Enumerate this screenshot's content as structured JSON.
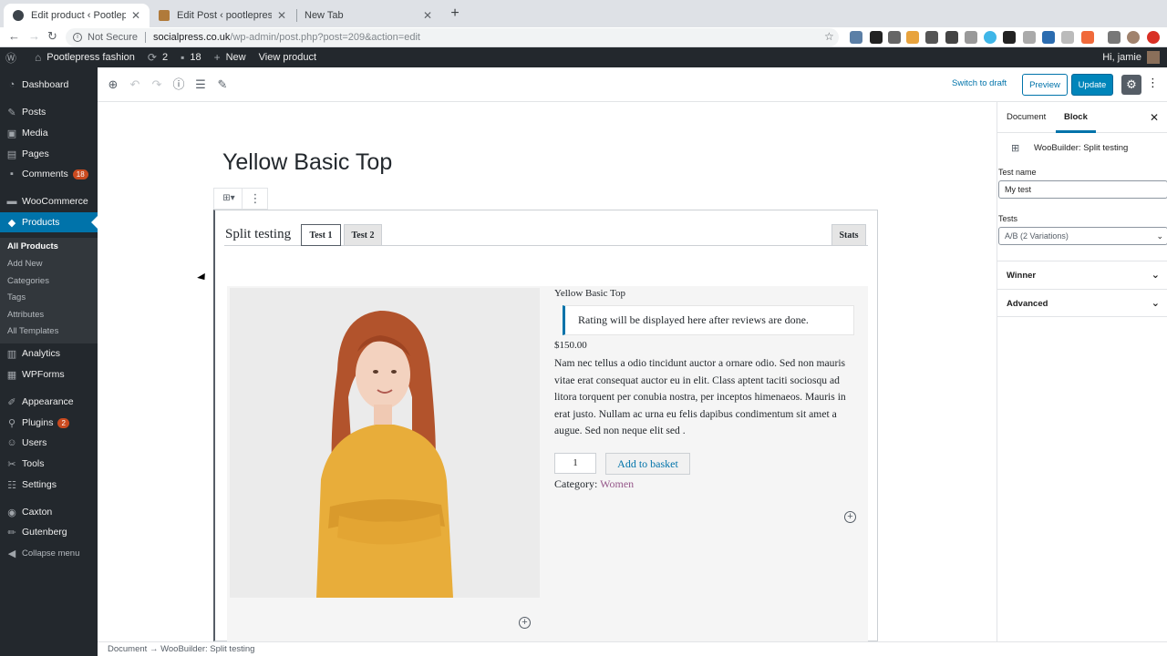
{
  "browser": {
    "tabs": [
      {
        "title": "Edit product ‹ Pootlepress fashion",
        "active": true
      },
      {
        "title": "Edit Post ‹ pootlepress — WordPress",
        "active": false
      },
      {
        "title": "New Tab",
        "active": false
      }
    ],
    "security": "Not Secure",
    "url_host": "socialpress.co.uk",
    "url_path": "/wp-admin/post.php?post=209&action=edit"
  },
  "adminbar": {
    "site": "Pootlepress fashion",
    "updates": "2",
    "comments": "18",
    "new": "New",
    "view": "View product",
    "howdy": "Hi, jamie"
  },
  "sidebar": {
    "items": [
      {
        "label": "Dashboard",
        "icon": "dashboard-icon"
      },
      {
        "label": "Posts",
        "icon": "pin-icon"
      },
      {
        "label": "Media",
        "icon": "media-icon"
      },
      {
        "label": "Pages",
        "icon": "pages-icon"
      },
      {
        "label": "Comments",
        "icon": "comment-icon",
        "badge": "18"
      },
      {
        "label": "WooCommerce",
        "icon": "woo-icon"
      },
      {
        "label": "Products",
        "icon": "products-icon"
      },
      {
        "label": "Analytics",
        "icon": "chart-icon"
      },
      {
        "label": "WPForms",
        "icon": "forms-icon"
      },
      {
        "label": "Appearance",
        "icon": "brush-icon"
      },
      {
        "label": "Plugins",
        "icon": "plugin-icon",
        "badge": "2"
      },
      {
        "label": "Users",
        "icon": "users-icon"
      },
      {
        "label": "Tools",
        "icon": "wrench-icon"
      },
      {
        "label": "Settings",
        "icon": "settings-icon"
      },
      {
        "label": "Caxton",
        "icon": "caxton-icon"
      },
      {
        "label": "Gutenberg",
        "icon": "pencil-icon"
      },
      {
        "label": "Collapse menu",
        "icon": "collapse-icon"
      }
    ],
    "submenu": [
      "All Products",
      "Add New",
      "Categories",
      "Tags",
      "Attributes",
      "All Templates"
    ]
  },
  "editor": {
    "switch_draft": "Switch to draft",
    "preview": "Preview",
    "update": "Update"
  },
  "content": {
    "title": "Yellow Basic Top",
    "split_label": "Split testing",
    "test_tabs": [
      "Test 1",
      "Test 2"
    ],
    "stats": "Stats",
    "product_title": "Yellow Basic Top",
    "rating_notice": "Rating will be displayed here after reviews are done.",
    "price": "$150.00",
    "description": "Nam nec tellus a odio tincidunt auctor a ornare odio. Sed non mauris vitae erat consequat auctor eu in elit. Class aptent taciti sociosqu ad litora torquent per conubia nostra, per inceptos himenaeos. Mauris in erat justo. Nullam ac urna eu felis dapibus condimentum sit amet a augue. Sed non neque elit sed .",
    "quantity": "1",
    "add_to_basket": "Add to basket",
    "category_label": "Category:",
    "category_value": "Women"
  },
  "panel": {
    "tabs": [
      "Document",
      "Block"
    ],
    "block_name": "WooBuilder: Split testing",
    "test_name_label": "Test name",
    "test_name_value": "My test",
    "tests_label": "Tests",
    "tests_value": "A/B (2 Variations)",
    "sections": [
      "Winner",
      "Advanced"
    ]
  },
  "footer": {
    "crumb_root": "Document",
    "crumb_block": "WooBuilder: Split testing"
  },
  "colors": {
    "wp_blue": "#0073aa",
    "admin_dark": "#23282d",
    "badge": "#ca4a1f",
    "category_link": "#96588a"
  }
}
